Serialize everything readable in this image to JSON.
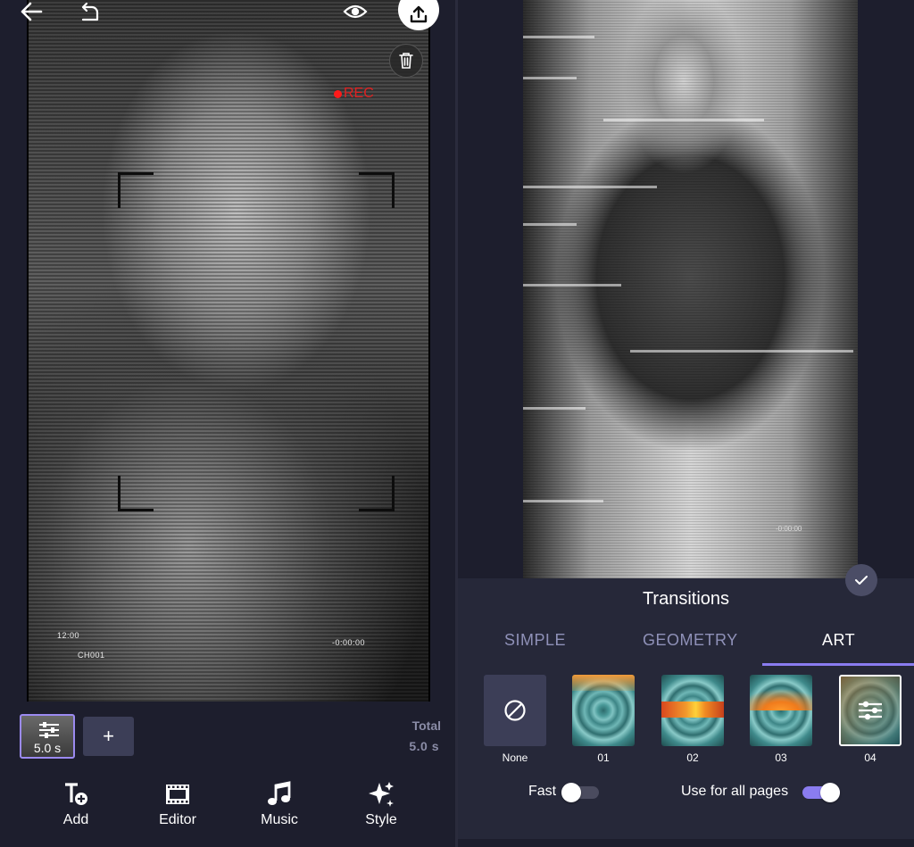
{
  "editor": {
    "rec_label": "REC",
    "overlay_time": "12:00",
    "overlay_channel": "CH001",
    "overlay_counter": "-0:00:00",
    "clip_duration": "5.0 s",
    "total_label": "Total",
    "total_value": "5.0 s",
    "add_clip_label": "+",
    "toolbar": [
      {
        "label": "Add",
        "icon": "add-text-icon"
      },
      {
        "label": "Editor",
        "icon": "film-icon"
      },
      {
        "label": "Music",
        "icon": "music-note-icon"
      },
      {
        "label": "Style",
        "icon": "sparkle-icon"
      }
    ]
  },
  "preview_right": {
    "overlay_counter": "-0:00:00"
  },
  "transitions": {
    "title": "Transitions",
    "tabs": [
      {
        "label": "SIMPLE",
        "active": false
      },
      {
        "label": "GEOMETRY",
        "active": false
      },
      {
        "label": "ART",
        "active": true
      }
    ],
    "items": [
      {
        "label": "None",
        "selected": false
      },
      {
        "label": "01",
        "selected": false
      },
      {
        "label": "02",
        "selected": false
      },
      {
        "label": "03",
        "selected": false
      },
      {
        "label": "04",
        "selected": true
      }
    ],
    "fast_label": "Fast",
    "fast_on": false,
    "use_all_label": "Use for all pages",
    "use_all_on": true
  },
  "colors": {
    "accent": "#8a7cf0",
    "background": "#1d1e2d",
    "rec": "#e02020"
  }
}
